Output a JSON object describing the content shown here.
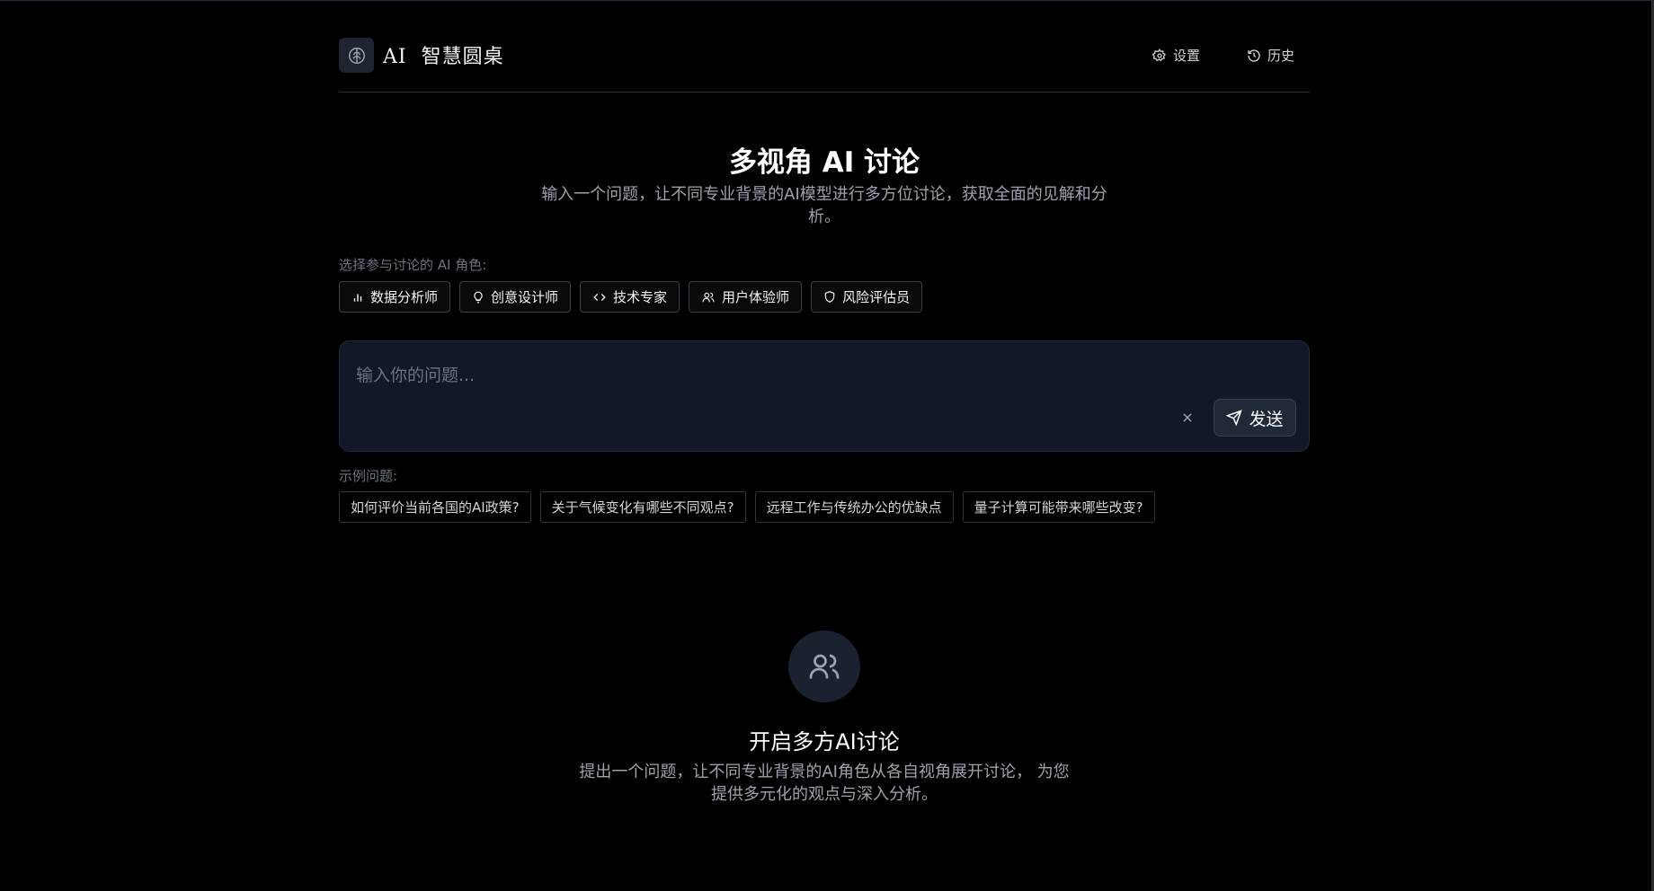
{
  "header": {
    "brand": "AI  智慧圆桌",
    "settings_label": "设置",
    "history_label": "历史"
  },
  "hero": {
    "title": "多视角 AI 讨论",
    "subtitle": "输入一个问题，让不同专业背景的AI模型进行多方位讨论，获取全面的见解和分析。"
  },
  "roles": {
    "label": "选择参与讨论的 AI 角色:",
    "items": [
      {
        "label": "数据分析师",
        "icon": "bar-chart-icon"
      },
      {
        "label": "创意设计师",
        "icon": "lightbulb-icon"
      },
      {
        "label": "技术专家",
        "icon": "code-icon"
      },
      {
        "label": "用户体验师",
        "icon": "users-icon"
      },
      {
        "label": "风险评估员",
        "icon": "shield-icon"
      }
    ]
  },
  "input": {
    "placeholder": "输入你的问题...",
    "value": "",
    "send_label": "发送"
  },
  "examples": {
    "label": "示例问题:",
    "items": [
      "如何评价当前各国的AI政策?",
      "关于气候变化有哪些不同观点?",
      "远程工作与传统办公的优缺点",
      "量子计算可能带来哪些改变?"
    ]
  },
  "empty_state": {
    "title": "开启多方AI讨论",
    "subtitle": "提出一个问题，让不同专业背景的AI角色从各自视角展开讨论， 为您提供多元化的观点与深入分析。"
  },
  "colors": {
    "background": "#000000",
    "card": "#111827",
    "muted_text": "#9ca3af"
  }
}
